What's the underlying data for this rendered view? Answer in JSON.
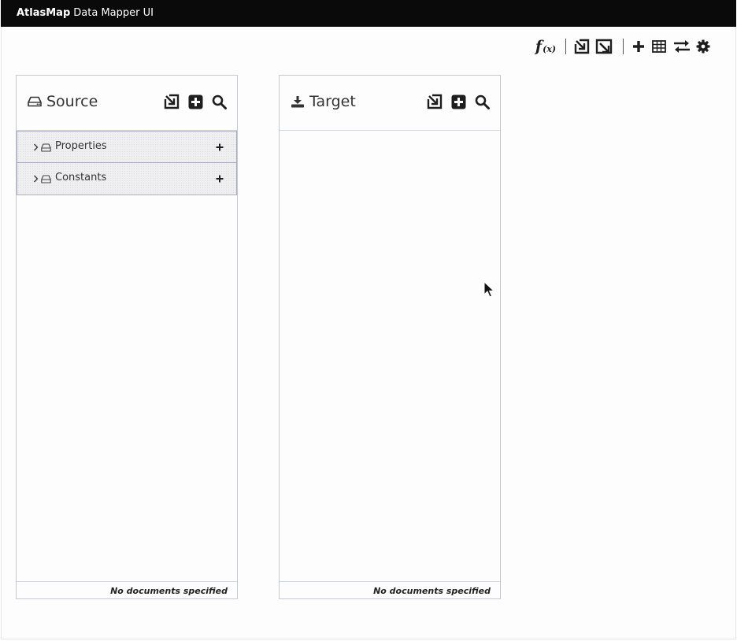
{
  "app": {
    "brand": "AtlasMap",
    "subtitle": "Data Mapper UI"
  },
  "toolbar": {
    "items": [
      {
        "icon": "function-icon",
        "label": "f",
        "sub": "(x)"
      },
      {
        "icon": "import-icon"
      },
      {
        "icon": "export-icon"
      },
      {
        "icon": "plus-icon"
      },
      {
        "icon": "table-icon"
      },
      {
        "icon": "exchange-icon"
      },
      {
        "icon": "gear-icon"
      }
    ]
  },
  "source": {
    "title": "Source",
    "icon": "hdd-icon",
    "tools": [
      "import-icon",
      "plus-square-icon",
      "search-icon"
    ],
    "documents": [
      {
        "name": "Properties"
      },
      {
        "name": "Constants"
      }
    ],
    "footer": "No documents specified"
  },
  "target": {
    "title": "Target",
    "icon": "download-icon",
    "tools": [
      "import-icon",
      "plus-square-icon",
      "search-icon"
    ],
    "documents": [],
    "footer": "No documents specified"
  },
  "colors": {
    "masthead": "#0a0a0a",
    "panel_border": "#c5c7d2",
    "row_bg": "#efeff1",
    "row_border": "#a9acc2",
    "icon": "#1e1e1e"
  }
}
